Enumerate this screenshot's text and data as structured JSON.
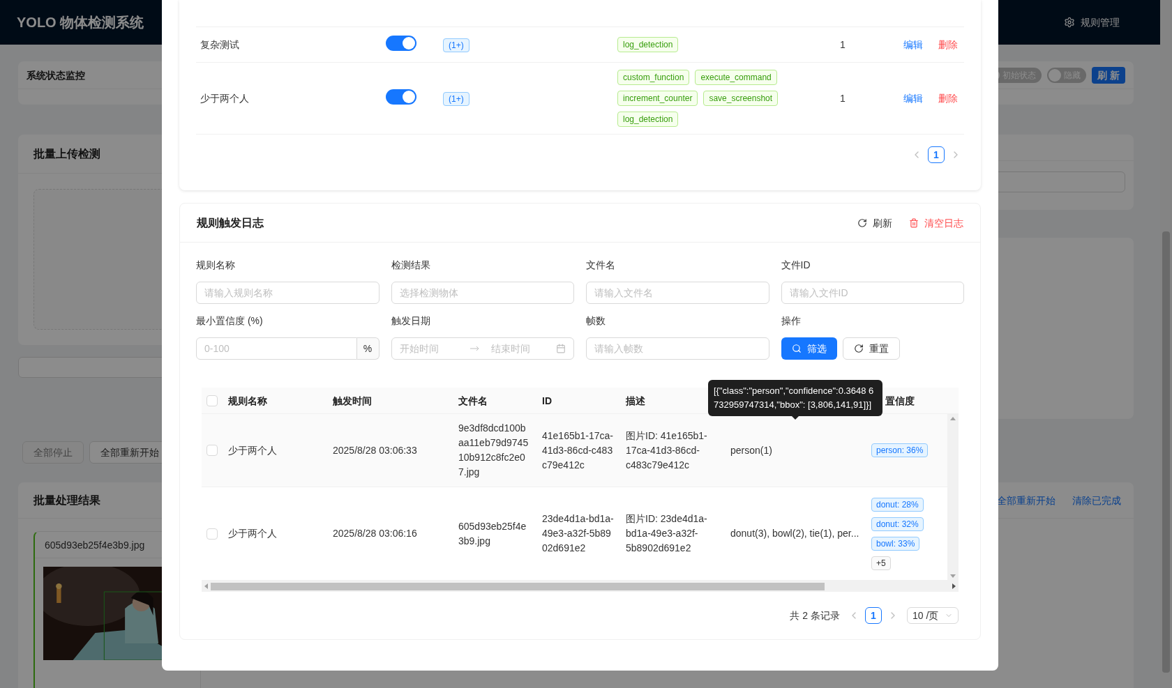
{
  "app": {
    "title": "YOLO 物体检测系统",
    "nav_item": "规则管理"
  },
  "status_card": {
    "title": "系统状态监控",
    "switches": [
      {
        "label": "初始状态",
        "on": false
      },
      {
        "label": "隐藏",
        "on": false
      }
    ],
    "refresh_button": "刷 新"
  },
  "upload_card": {
    "title": "批量上传检测"
  },
  "batch_buttons": [
    {
      "label": "全部停止",
      "disabled": true
    },
    {
      "label": "全部重新开始",
      "disabled": false
    }
  ],
  "results_card": {
    "title": "批量处理结果",
    "links": [
      "全部重新开始",
      "清除已完成"
    ],
    "item": {
      "file_name": "605d93eb25f4e3b9.jpg"
    }
  },
  "rules_table": {
    "rows": [
      {
        "name": "复杂测试",
        "enabled": true,
        "condition": "(1+)",
        "actions": [
          "log_detection"
        ],
        "count": "1",
        "edit": "编辑",
        "delete": "删除"
      },
      {
        "name": "少于两个人",
        "enabled": true,
        "condition": "(1+)",
        "actions": [
          "custom_function",
          "execute_command",
          "increment_counter",
          "save_screenshot",
          "log_detection"
        ],
        "count": "1",
        "edit": "编辑",
        "delete": "删除"
      }
    ],
    "pages": [
      {
        "label": "1",
        "selected": true
      }
    ]
  },
  "log_card": {
    "title": "规则触发日志",
    "refresh": "刷新",
    "clear": "清空日志",
    "filters": [
      {
        "label": "规则名称",
        "kind": "text",
        "placeholder": "请输入规则名称"
      },
      {
        "label": "检测结果",
        "kind": "text",
        "placeholder": "选择检测物体"
      },
      {
        "label": "文件名",
        "kind": "text",
        "placeholder": "请输入文件名"
      },
      {
        "label": "文件ID",
        "kind": "text",
        "placeholder": "请输入文件ID"
      },
      {
        "label": "最小置信度 (%)",
        "kind": "suffix",
        "placeholder": "0-100",
        "suffix": "%"
      },
      {
        "label": "触发日期",
        "kind": "range",
        "placeholder": "开始时间",
        "placeholder_end": "结束时间"
      },
      {
        "label": "帧数",
        "kind": "text",
        "placeholder": "请输入帧数"
      },
      {
        "label": "操作",
        "kind": "actions",
        "buttons": [
          "筛选",
          "重置"
        ]
      }
    ],
    "table": {
      "columns": [
        "规则名称",
        "触发时间",
        "文件名",
        "ID",
        "描述",
        "置信度"
      ],
      "header_checked": false,
      "rows": [
        {
          "checked": false,
          "highlighted": true,
          "name": "少于两个人",
          "time": "2025/8/28 03:06:33",
          "file": "9e3df8dcd100baa11eb79d974510b912c8fc2e07.jpg",
          "id": "41e165b1-17ca-41d3-86cd-c483c79e412c",
          "desc": "图片ID: 41e165b1-17ca-41d3-86cd-c483c79e412c",
          "objects": "person(1)",
          "confidence": [
            {
              "kind": "value",
              "text": "person: 36%"
            }
          ]
        },
        {
          "checked": false,
          "highlighted": false,
          "name": "少于两个人",
          "time": "2025/8/28 03:06:16",
          "file": "605d93eb25f4e3b9.jpg",
          "id": "23de4d1a-bd1a-49e3-a32f-5b8902d691e2",
          "desc": "图片ID: 23de4d1a-bd1a-49e3-a32f-5b8902d691e2",
          "objects": "donut(3), bowl(2), tie(1), per...",
          "confidence": [
            {
              "kind": "value",
              "text": "donut: 28%"
            },
            {
              "kind": "value",
              "text": "donut: 32%"
            },
            {
              "kind": "value",
              "text": "bowl: 33%"
            },
            {
              "kind": "more",
              "text": "+5"
            }
          ]
        }
      ]
    },
    "tooltip": "[{\"class\":\"person\",\"confidence\":0.3648 6732959747314,\"bbox\": [3,806,141,91]}]",
    "total": "共 2 条记录",
    "pages": [
      {
        "label": "1",
        "selected": true
      }
    ],
    "page_size": "10 /页"
  }
}
